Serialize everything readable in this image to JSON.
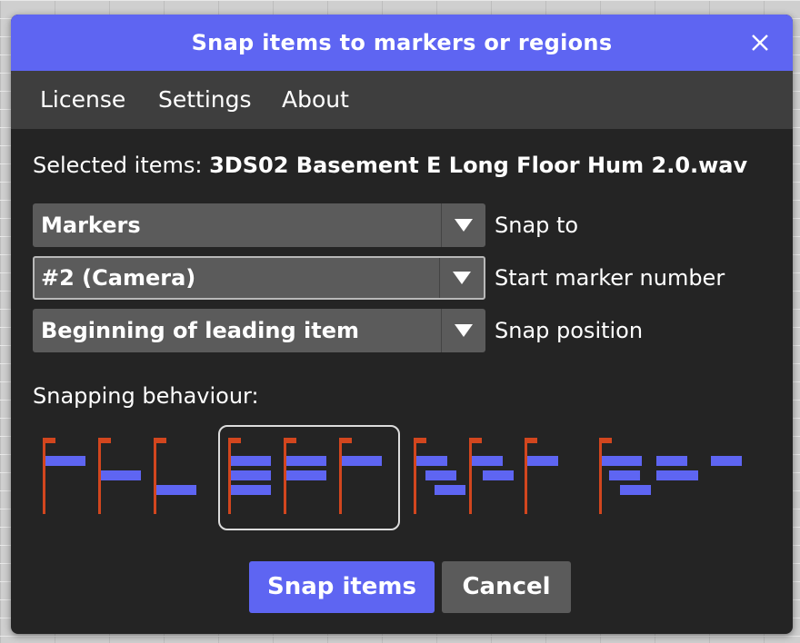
{
  "dialog": {
    "title": "Snap items to markers or regions",
    "close_icon": "close-icon"
  },
  "menu": {
    "items": [
      {
        "label": "License"
      },
      {
        "label": "Settings"
      },
      {
        "label": "About"
      }
    ]
  },
  "selected": {
    "prefix": "Selected items: ",
    "value": "3DS02 Basement E Long Floor Hum 2.0.wav"
  },
  "fields": [
    {
      "value": "Markers",
      "label": "Snap to",
      "icon": "triangle-down-icon"
    },
    {
      "value": "#2 (Camera)",
      "label": "Start marker number",
      "icon": "triangle-down-icon",
      "focused": true
    },
    {
      "value": "Beginning of leading item",
      "label": "Snap position",
      "icon": "triangle-down-icon"
    }
  ],
  "behaviour": {
    "label": "Snapping behaviour:",
    "options": [
      {
        "name": "staggered-single",
        "selected": false
      },
      {
        "name": "stacked-groups",
        "selected": true
      },
      {
        "name": "staggered-groups",
        "selected": false
      },
      {
        "name": "sequential-groups",
        "selected": false
      }
    ]
  },
  "actions": {
    "snap_label": "Snap items",
    "cancel_label": "Cancel"
  },
  "colors": {
    "accent": "#5e65f2",
    "marker": "#d2461e",
    "item_block": "#5e65f2",
    "dialog_bg": "#242424",
    "menubar_bg": "#3e3e3e",
    "control_bg": "#5b5b5b"
  }
}
